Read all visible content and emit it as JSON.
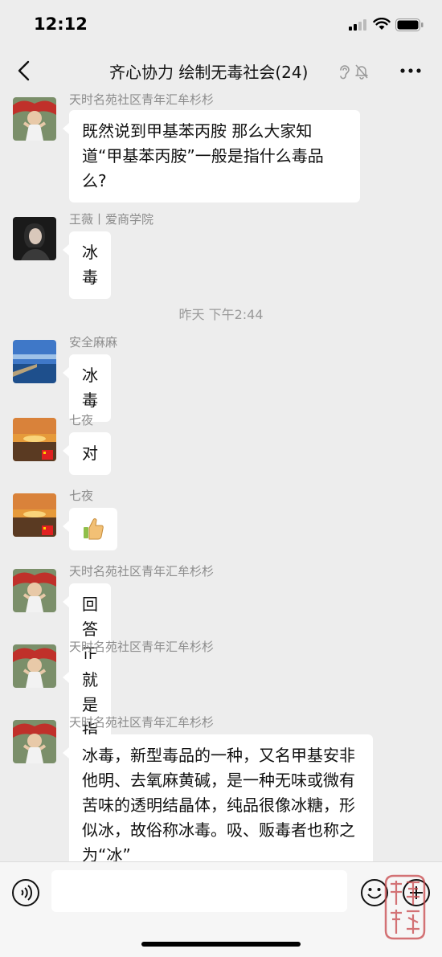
{
  "status_bar": {
    "time": "12:12"
  },
  "header": {
    "title": "齐心协力 绘制无毒社会(24)"
  },
  "messages": [
    {
      "sender": "天时名苑社区青年汇牟杉杉",
      "text": "既然说到甲基苯丙胺 那么大家知道“甲基苯丙胺”一般是指什么毒品么?"
    },
    {
      "sender": "王薇丨爱商学院",
      "text": "冰毒"
    },
    {
      "sender": "安全麻麻",
      "text": "冰毒"
    },
    {
      "sender": "七夜",
      "text": "对"
    },
    {
      "sender": "七夜",
      "text": ""
    },
    {
      "sender": "天时名苑社区青年汇牟杉杉",
      "text": "回答正确"
    },
    {
      "sender": "天时名苑社区青年汇牟杉杉",
      "text": "就是指冰毒"
    },
    {
      "sender": "天时名苑社区青年汇牟杉杉",
      "text": "冰毒，新型毒品的一种，又名甲基安非他明、去氧麻黄碱，是一种无味或微有苦味的透明结晶体，纯品很像冰糖，形似冰，故俗称冰毒。吸、贩毒者也称之为“冰”"
    }
  ],
  "time_separator": "昨天 下午2:44",
  "stamp_text": "禁毒 布绿",
  "icons": {
    "back": "chevron-left-icon",
    "ear": "ear-icon",
    "mute": "bell-off-icon",
    "more": "more-icon",
    "voice": "voice-icon",
    "emoji": "emoji-icon",
    "plus": "plus-icon",
    "thumbs_up": "thumbs-up-icon"
  }
}
